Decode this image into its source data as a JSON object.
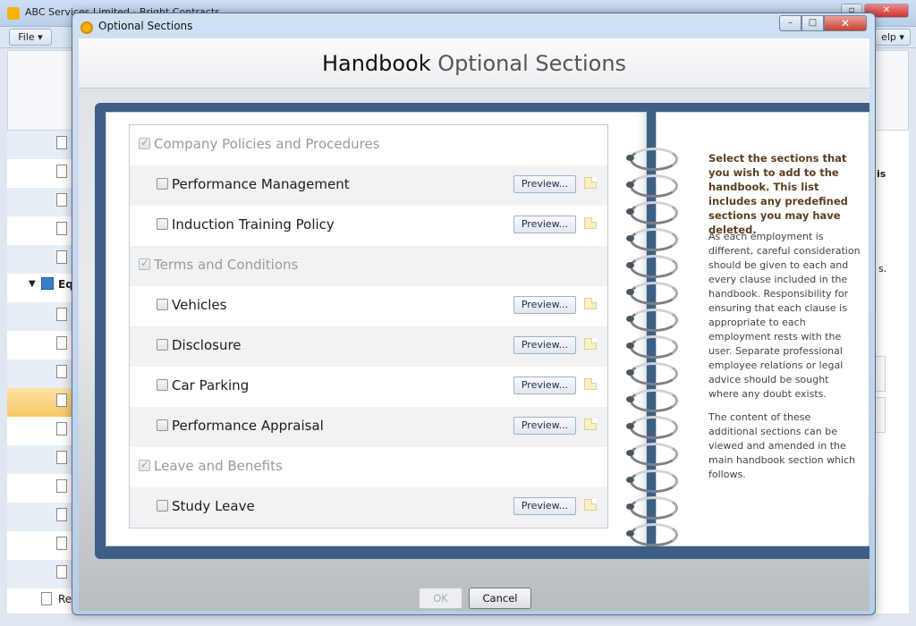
{
  "background_app": {
    "title": "ABC Services Limited - Bright Contracts",
    "file_menu": "File ▾",
    "help_menu": "elp ▾",
    "tree_folder": "Equ",
    "tree_last": "Re",
    "right_panel_fragment_1": "is",
    "right_panel_fragment_2": "s."
  },
  "dialog": {
    "title": "Optional Sections",
    "minimize_glyph": "–",
    "maximize_glyph": "□",
    "close_glyph": "✕"
  },
  "header": {
    "bold": "Handbook",
    "light": "Optional Sections"
  },
  "sections": [
    {
      "type": "group",
      "label": "Company Policies and Procedures",
      "checked": true
    },
    {
      "type": "item",
      "label": "Performance Management",
      "checked": false
    },
    {
      "type": "item",
      "label": "Induction Training Policy",
      "checked": false
    },
    {
      "type": "group",
      "label": "Terms and Conditions",
      "checked": true
    },
    {
      "type": "item",
      "label": "Vehicles",
      "checked": false
    },
    {
      "type": "item",
      "label": "Disclosure",
      "checked": false
    },
    {
      "type": "item",
      "label": "Car Parking",
      "checked": false
    },
    {
      "type": "item",
      "label": "Performance Appraisal",
      "checked": false
    },
    {
      "type": "group",
      "label": "Leave and Benefits",
      "checked": true
    },
    {
      "type": "item",
      "label": "Study Leave",
      "checked": false
    }
  ],
  "preview_label": "Preview...",
  "instructions": {
    "bold": "Select the sections that you wish to add to the handbook. This list includes any predefined sections you may have deleted.",
    "para1": "As each employment is different, careful consideration should be given to each and every clause included in the handbook. Responsibility for ensuring that each clause is appropriate to each employment rests with the user. Separate professional employee relations or legal advice should be sought where any doubt exists.",
    "para2": "The content of these additional sections can be viewed and amended in the main handbook section which follows."
  },
  "buttons": {
    "ok": "OK",
    "cancel": "Cancel"
  }
}
